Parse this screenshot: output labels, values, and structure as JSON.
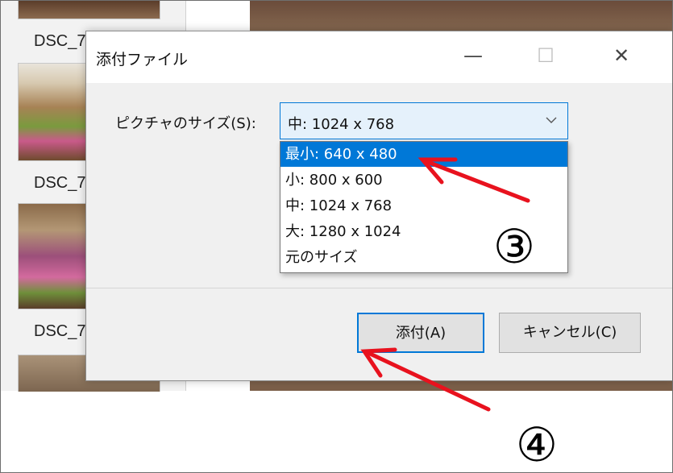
{
  "thumbnails": [
    {
      "label": "DSC_7"
    },
    {
      "label": "DSC_7"
    },
    {
      "label": "DSC_7"
    }
  ],
  "dialog": {
    "title": "添付ファイル",
    "controls": {
      "minimize": "—",
      "maximize": "☐",
      "close": "✕"
    },
    "size_label": "ピクチャのサイズ(S):",
    "selected_value": "中: 1024 x 768",
    "options": [
      "最小: 640 x 480",
      "小: 800 x 600",
      "中: 1024 x 768",
      "大: 1280 x 1024",
      "元のサイズ"
    ],
    "highlighted_option_index": 0,
    "attach_button": "添付(A)",
    "cancel_button": "キャンセル(C)"
  },
  "annotations": {
    "step3": "③",
    "step4": "④",
    "arrow_color": "#e8121e"
  },
  "colors": {
    "accent": "#0078d7",
    "selection": "#0078d7"
  }
}
